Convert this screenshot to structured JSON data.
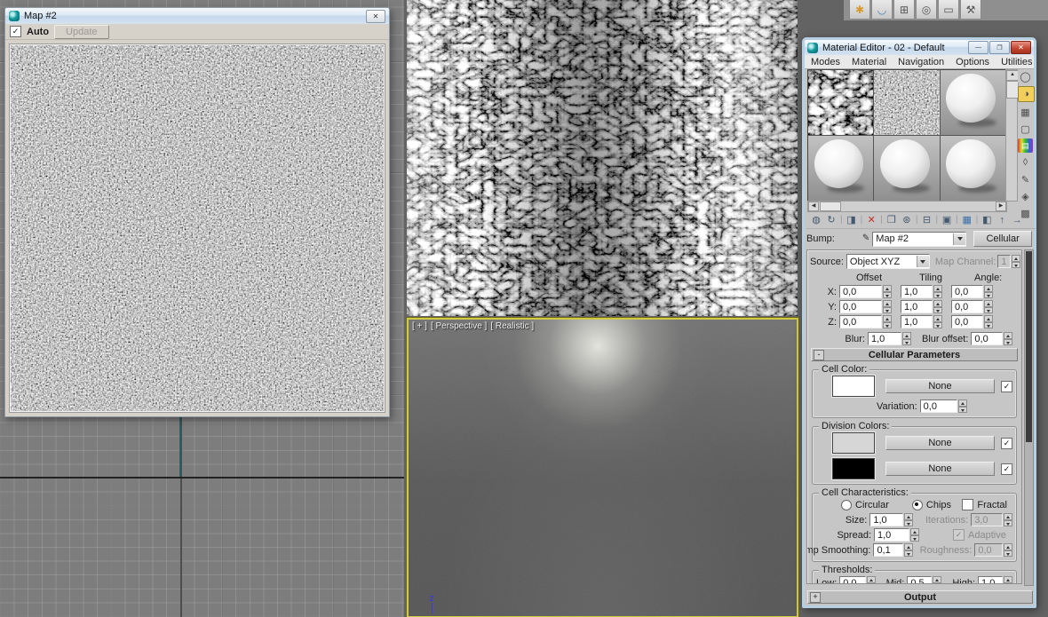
{
  "map_window": {
    "title": "Map #2",
    "close_glyph": "✕",
    "auto_label": "Auto",
    "auto_check": "✓",
    "update_label": "Update"
  },
  "perspective_viewport": {
    "label_plus": "[ + ]",
    "label_view": "[ Perspective ]",
    "label_shading": "[ Realistic ]",
    "axis_label": "Z",
    "border_color": "#d2ca45"
  },
  "command_panel_tabs": [
    {
      "name": "create",
      "glyph": "✱"
    },
    {
      "name": "modify",
      "glyph": "◡"
    },
    {
      "name": "hierarchy",
      "glyph": "⊞"
    },
    {
      "name": "motion",
      "glyph": "◎"
    },
    {
      "name": "display",
      "glyph": "▭"
    },
    {
      "name": "utilities",
      "glyph": "⚒"
    }
  ],
  "material_editor": {
    "title": "Material Editor - 02 - Default",
    "window_buttons": {
      "minimize": "—",
      "maximize": "❐",
      "close": "✕"
    },
    "menus": [
      "Modes",
      "Material",
      "Navigation",
      "Options",
      "Utilities"
    ],
    "toolbar_icons": [
      {
        "name": "get-material",
        "glyph": "◍",
        "color": "#44596e"
      },
      {
        "name": "put-material-to-scene",
        "glyph": "↻",
        "color": "#44596e"
      },
      {
        "name": "assign-material-to-selection",
        "glyph": "◨",
        "color": "#44596e"
      },
      {
        "name": "reset-map",
        "glyph": "✕",
        "color": "#c03028"
      },
      {
        "name": "make-material-copy",
        "glyph": "❒",
        "color": "#44596e"
      },
      {
        "name": "make-unique",
        "glyph": "⊛",
        "color": "#44596e"
      },
      {
        "name": "put-to-library",
        "glyph": "⊟",
        "color": "#44596e"
      },
      {
        "name": "material-id-channel",
        "glyph": "▣",
        "color": "#44596e"
      },
      {
        "name": "show-shaded-material-in-viewport",
        "glyph": "▦",
        "color": "#3a6ea8"
      },
      {
        "name": "show-end-result",
        "glyph": "◧",
        "color": "#44596e"
      },
      {
        "name": "go-to-parent",
        "glyph": "↑",
        "color": "#44596e"
      },
      {
        "name": "go-forward-to-sibling",
        "glyph": "→",
        "color": "#44596e"
      }
    ],
    "side_toolbar": [
      {
        "name": "sample-type-sphere",
        "glyph": "◯"
      },
      {
        "name": "backlight",
        "glyph": "◑",
        "active": true
      },
      {
        "name": "background",
        "glyph": "▦"
      },
      {
        "name": "sample-uv-tiling",
        "glyph": "▢"
      },
      {
        "name": "video-color-check",
        "glyph": "▤"
      },
      {
        "name": "generate-preview",
        "glyph": "◊"
      },
      {
        "name": "options",
        "glyph": "✎"
      },
      {
        "name": "select-by-material",
        "glyph": "◈"
      },
      {
        "name": "material-map-navigator",
        "glyph": "▩"
      }
    ],
    "bump": {
      "label": "Bump:",
      "pick_glyph": "✐",
      "map_name": "Map #2",
      "map_type_button": "Cellular"
    },
    "coordinates": {
      "source_label": "Source:",
      "source_value": "Object XYZ",
      "map_channel_label": "Map Channel:",
      "map_channel_value": "1",
      "offset_header": "Offset",
      "tiling_header": "Tiling",
      "angle_header": "Angle:",
      "rows": [
        {
          "axis": "X:",
          "offset": "0,0",
          "tiling": "1,0",
          "angle": "0,0"
        },
        {
          "axis": "Y:",
          "offset": "0,0",
          "tiling": "1,0",
          "angle": "0,0"
        },
        {
          "axis": "Z:",
          "offset": "0,0",
          "tiling": "1,0",
          "angle": "0,0"
        }
      ],
      "blur_label": "Blur:",
      "blur_value": "1,0",
      "blur_offset_label": "Blur offset:",
      "blur_offset_value": "0,0"
    },
    "cellular_parameters": {
      "header": "Cellular Parameters",
      "collapse_glyph": "-",
      "cell_color": {
        "legend": "Cell Color:",
        "swatch_color": "#ffffff",
        "none_label": "None",
        "check": "✓",
        "variation_label": "Variation:",
        "variation_value": "0,0"
      },
      "division_colors": {
        "legend": "Division Colors:",
        "swatch_top_color": "#d6d6d6",
        "swatch_bottom_color": "#000000",
        "none_top_label": "None",
        "none_bottom_label": "None",
        "check": "✓"
      },
      "cell_characteristics": {
        "legend": "Cell Characteristics:",
        "circular_label": "Circular",
        "chips_label": "Chips",
        "fractal_label": "Fractal",
        "size_label": "Size:",
        "size_value": "1,0",
        "iterations_label": "Iterations:",
        "iterations_value": "3,0",
        "spread_label": "Spread:",
        "spread_value": "1,0",
        "adaptive_label": "Adaptive",
        "adaptive_check": "✓",
        "bump_smoothing_label": "Bump Smoothing:",
        "bump_smoothing_value": "0,1",
        "roughness_label": "Roughness:",
        "roughness_value": "0,0"
      },
      "thresholds": {
        "legend": "Thresholds:",
        "low_label": "Low:",
        "low_value": "0,0",
        "mid_label": "Mid:",
        "mid_value": "0,5",
        "high_label": "High:",
        "high_value": "1,0"
      }
    },
    "output_header": "Output",
    "expand_glyph": "+"
  }
}
